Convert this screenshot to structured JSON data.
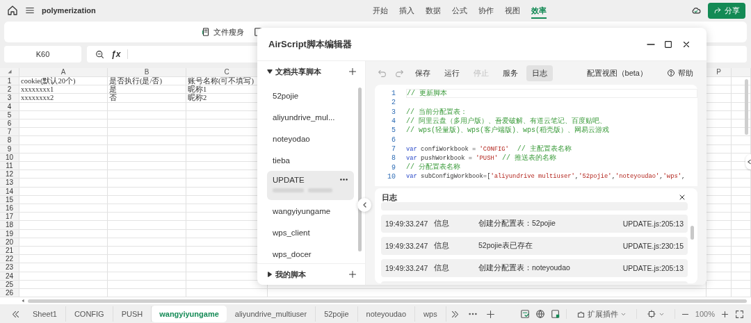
{
  "app": {
    "file_name": "polymerization",
    "share_button": "分享",
    "menu": [
      {
        "label": "开始",
        "selected": false
      },
      {
        "label": "插入",
        "selected": false
      },
      {
        "label": "数据",
        "selected": false
      },
      {
        "label": "公式",
        "selected": false
      },
      {
        "label": "协作",
        "selected": false
      },
      {
        "label": "视图",
        "selected": false
      },
      {
        "label": "效率",
        "selected": true
      }
    ]
  },
  "ribbon": {
    "items": [
      {
        "label": "文件瘦身"
      }
    ]
  },
  "formula_bar": {
    "cell_ref": "K60",
    "fx": "ƒx"
  },
  "sheet": {
    "columns": [
      "A",
      "B",
      "C",
      "P"
    ],
    "rows": [
      {
        "number": "1",
        "cells": [
          "cookie(默认20个)",
          "是否执行(是/否)",
          "账号名称(可不填写)"
        ]
      },
      {
        "number": "2",
        "cells": [
          "xxxxxxxx1",
          "是",
          "昵称1"
        ]
      },
      {
        "number": "3",
        "cells": [
          "xxxxxxxx2",
          "否",
          "昵称2"
        ]
      }
    ],
    "empty_rows": [
      "4",
      "5",
      "6",
      "7",
      "8",
      "9",
      "10",
      "11",
      "12",
      "13",
      "14",
      "15",
      "16",
      "17",
      "18",
      "19",
      "20",
      "21",
      "22",
      "23",
      "24",
      "25",
      "26"
    ]
  },
  "dialog": {
    "title": "AirScript脚本编辑器",
    "shared_section": {
      "label": "文档共享脚本",
      "expanded": true
    },
    "scripts": [
      {
        "name": "52pojie",
        "selected": false
      },
      {
        "name": "aliyundrive_mul...",
        "selected": false
      },
      {
        "name": "noteyodao",
        "selected": false
      },
      {
        "name": "tieba",
        "selected": false
      },
      {
        "name": "UPDATE",
        "selected": true
      },
      {
        "name": "wangyiyungame",
        "selected": false
      },
      {
        "name": "wps_client",
        "selected": false
      },
      {
        "name": "wps_docer",
        "selected": false
      }
    ],
    "my_section": {
      "label": "我的脚本",
      "expanded": false
    },
    "toolbar": [
      {
        "label": "保存",
        "disabled": false,
        "selected": false
      },
      {
        "label": "运行",
        "disabled": false,
        "selected": false
      },
      {
        "label": "停止",
        "disabled": true,
        "selected": false
      },
      {
        "label": "服务",
        "disabled": false,
        "selected": false
      },
      {
        "label": "日志",
        "disabled": false,
        "selected": true
      }
    ],
    "config_view": "配置视图（beta）",
    "help": "帮助",
    "code_lines": [
      {
        "number": "1",
        "tokens": [
          {
            "kind": "comment",
            "text": "// 更新脚本"
          }
        ]
      },
      {
        "number": "2"
      },
      {
        "number": "3",
        "tokens": [
          {
            "kind": "comment",
            "text": "// 当前分配置表："
          }
        ]
      },
      {
        "number": "4",
        "tokens": [
          {
            "kind": "comment",
            "text": "// 阿里云盘（多用户版）、吾爱破解、有道云笔记、百度贴吧、"
          }
        ]
      },
      {
        "number": "5",
        "tokens": [
          {
            "kind": "comment",
            "text": "// wps(轻量版)、wps(客户端版)、wps(稻壳版）、网易云游戏"
          }
        ]
      },
      {
        "number": "6"
      },
      {
        "number": "7",
        "tokens": [
          {
            "kind": "keyword",
            "text": "var"
          },
          {
            "kind": "plain",
            "text": " confiWorkbook = "
          },
          {
            "kind": "string",
            "text": "'CONFIG'"
          },
          {
            "kind": "comment",
            "text": "  // 主配置表名称"
          }
        ]
      },
      {
        "number": "8",
        "tokens": [
          {
            "kind": "keyword",
            "text": "var"
          },
          {
            "kind": "plain",
            "text": " pushWorkbook = "
          },
          {
            "kind": "string",
            "text": "'PUSH'"
          },
          {
            "kind": "comment",
            "text": " // 推送表的名称"
          }
        ]
      },
      {
        "number": "9",
        "tokens": [
          {
            "kind": "comment",
            "text": "// 分配置表名称"
          }
        ]
      },
      {
        "number": "10",
        "tokens": [
          {
            "kind": "keyword",
            "text": "var"
          },
          {
            "kind": "plain",
            "text": " subConfigWorkbook=["
          },
          {
            "kind": "string",
            "text": "'aliyundrive multiuser'"
          },
          {
            "kind": "plain",
            "text": ","
          },
          {
            "kind": "string",
            "text": "'52pojie'"
          },
          {
            "kind": "plain",
            "text": ","
          },
          {
            "kind": "string",
            "text": "'noteyoudao'"
          },
          {
            "kind": "plain",
            "text": ","
          },
          {
            "kind": "string",
            "text": "'wps'"
          },
          {
            "kind": "plain",
            "text": ","
          }
        ]
      }
    ],
    "log": {
      "title": "日志",
      "entries": [
        {
          "time": "19:49:33.247",
          "level": "信息",
          "message": "创建分配置表：52pojie",
          "source": "UPDATE.js:205:13"
        },
        {
          "time": "19:49:33.247",
          "level": "信息",
          "message": "52pojie表已存在",
          "source": "UPDATE.js:230:15"
        },
        {
          "time": "19:49:33.247",
          "level": "信息",
          "message": "创建分配置表：noteyoudao",
          "source": "UPDATE.js:205:13"
        }
      ]
    }
  },
  "sheet_tabs": [
    {
      "label": "Sheet1",
      "selected": false
    },
    {
      "label": "CONFIG",
      "selected": false
    },
    {
      "label": "PUSH",
      "selected": false
    },
    {
      "label": "wangyiyungame",
      "selected": true
    },
    {
      "label": "aliyundrive_multiuser",
      "selected": false
    },
    {
      "label": "52pojie",
      "selected": false
    },
    {
      "label": "noteyoudao",
      "selected": false
    },
    {
      "label": "wps",
      "selected": false
    }
  ],
  "status": {
    "extensions": "扩展插件",
    "zoom": "100%"
  }
}
